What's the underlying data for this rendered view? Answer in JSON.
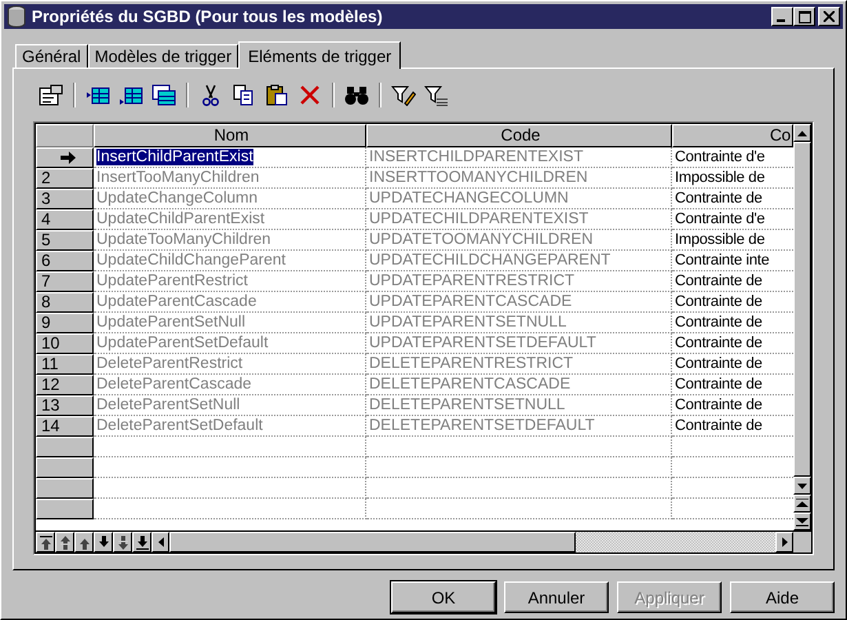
{
  "window": {
    "title": "Propriétés du SGBD (Pour tous les modèles)"
  },
  "tabs": [
    {
      "label": "Général",
      "selected": false
    },
    {
      "label": "Modèles de trigger",
      "selected": false
    },
    {
      "label": "Eléments de trigger",
      "selected": true
    }
  ],
  "table": {
    "columns": [
      "Nom",
      "Code",
      "Co"
    ],
    "rows": [
      {
        "selected": true,
        "nom": "InsertChildParentExist",
        "code": "INSERTCHILDPARENTEXIST",
        "column_3": "Contrainte d'e"
      },
      {
        "selected": false,
        "number": "2",
        "nom": "InsertTooManyChildren",
        "code": "INSERTTOOMANYCHILDREN",
        "column_3": "Impossible de"
      },
      {
        "selected": false,
        "number": "3",
        "nom": "UpdateChangeColumn",
        "code": "UPDATECHANGECOLUMN",
        "column_3": "Contrainte de"
      },
      {
        "selected": false,
        "number": "4",
        "nom": "UpdateChildParentExist",
        "code": "UPDATECHILDPARENTEXIST",
        "column_3": "Contrainte d'e"
      },
      {
        "selected": false,
        "number": "5",
        "nom": "UpdateTooManyChildren",
        "code": "UPDATETOOMANYCHILDREN",
        "column_3": "Impossible de"
      },
      {
        "selected": false,
        "number": "6",
        "nom": "UpdateChildChangeParent",
        "code": "UPDATECHILDCHANGEPARENT",
        "column_3": "Contrainte inte"
      },
      {
        "selected": false,
        "number": "7",
        "nom": "UpdateParentRestrict",
        "code": "UPDATEPARENTRESTRICT",
        "column_3": "Contrainte de"
      },
      {
        "selected": false,
        "number": "8",
        "nom": "UpdateParentCascade",
        "code": "UPDATEPARENTCASCADE",
        "column_3": "Contrainte de"
      },
      {
        "selected": false,
        "number": "9",
        "nom": "UpdateParentSetNull",
        "code": "UPDATEPARENTSETNULL",
        "column_3": "Contrainte de"
      },
      {
        "selected": false,
        "number": "10",
        "nom": "UpdateParentSetDefault",
        "code": "UPDATEPARENTSETDEFAULT",
        "column_3": "Contrainte de"
      },
      {
        "selected": false,
        "number": "11",
        "nom": "DeleteParentRestrict",
        "code": "DELETEPARENTRESTRICT",
        "column_3": "Contrainte de"
      },
      {
        "selected": false,
        "number": "12",
        "nom": "DeleteParentCascade",
        "code": "DELETEPARENTCASCADE",
        "column_3": "Contrainte de"
      },
      {
        "selected": false,
        "number": "13",
        "nom": "DeleteParentSetNull",
        "code": "DELETEPARENTSETNULL",
        "column_3": "Contrainte de"
      },
      {
        "selected": false,
        "number": "14",
        "nom": "DeleteParentSetDefault",
        "code": "DELETEPARENTSETDEFAULT",
        "column_3": "Contrainte de"
      }
    ]
  },
  "buttons": [
    {
      "label": "OK",
      "kind": "default",
      "disabled": false
    },
    {
      "label": "Annuler",
      "kind": "normal",
      "disabled": false
    },
    {
      "label": "Appliquer",
      "kind": "normal",
      "disabled": true
    },
    {
      "label": "Aide",
      "kind": "normal",
      "disabled": false
    }
  ]
}
